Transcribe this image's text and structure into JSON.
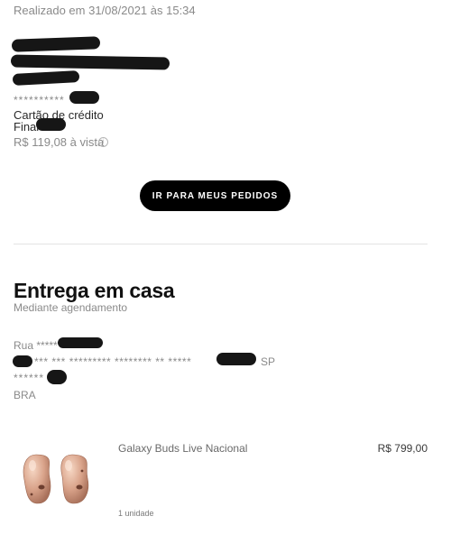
{
  "order": {
    "placed_at": "Realizado em 31/08/2021 às 15:34",
    "card_masked": "**********",
    "payment_method": "Cartão de crédito",
    "card_final_label": "Final",
    "total": "R$ 119,08 à vista",
    "info_icon": "info-icon",
    "cta_label": "IR PARA MEUS PEDIDOS"
  },
  "delivery": {
    "title": "Entrega em casa",
    "subtitle": "Mediante agendamento",
    "street_prefix": "Rua *****",
    "city_line": "*** *** ********* ******** ** *****",
    "state": "SP",
    "zip_masked": "******",
    "country": "BRA"
  },
  "product": {
    "name": "Galaxy Buds Live Nacional",
    "price": "R$ 799,00",
    "quantity": "1 unidade",
    "image": "earbuds-image"
  },
  "colors": {
    "cta_background": "#000000",
    "earbud_bronze": "#d9a38a"
  }
}
